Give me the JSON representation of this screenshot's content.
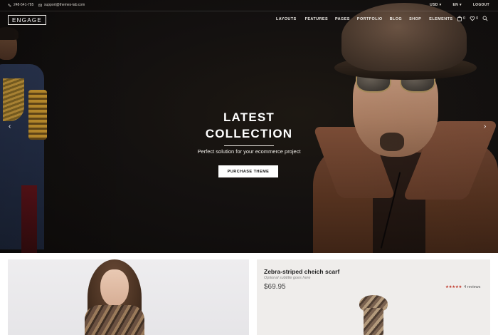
{
  "topbar": {
    "phone": "248-541-785",
    "email": "support@themes-lab.com",
    "currency": "USD",
    "language": "EN",
    "logout": "LOGOUT"
  },
  "header": {
    "logo": "ENGAGE",
    "nav": [
      "LAYOUTS",
      "FEATURES",
      "PAGES",
      "PORTFOLIO",
      "BLOG",
      "SHOP",
      "ELEMENTS"
    ],
    "cart_count": "0",
    "wishlist_count": "0"
  },
  "hero": {
    "title_line1": "LATEST",
    "title_line2": "COLLECTION",
    "subtitle": "Perfect solution for your ecommerce project",
    "button": "PURCHASE THEME"
  },
  "product": {
    "name": "Zebra-striped cheich scarf",
    "subtitle": "Optional subtitle goes here",
    "price": "$69.95",
    "rating": 4.5,
    "stars": "★★★★★",
    "reviews": "4 reviews"
  },
  "colors": {
    "hero_bg": "#141110",
    "accent_star": "#c0392b",
    "panel_bg": "#efedeb"
  }
}
